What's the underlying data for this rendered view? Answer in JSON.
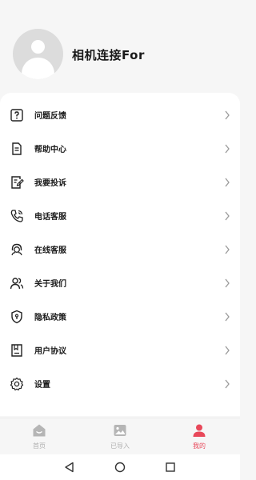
{
  "profile": {
    "username": "相机连接For"
  },
  "menu": {
    "items": [
      {
        "label": "问题反馈",
        "icon": "feedback-icon"
      },
      {
        "label": "帮助中心",
        "icon": "help-document-icon"
      },
      {
        "label": "我要投诉",
        "icon": "complaint-icon"
      },
      {
        "label": "电话客服",
        "icon": "phone-icon"
      },
      {
        "label": "在线客服",
        "icon": "headset-icon"
      },
      {
        "label": "关于我们",
        "icon": "people-icon"
      },
      {
        "label": "隐私政策",
        "icon": "shield-icon"
      },
      {
        "label": "用户协议",
        "icon": "agreement-icon"
      },
      {
        "label": "设置",
        "icon": "gear-icon"
      }
    ]
  },
  "tabbar": {
    "tabs": [
      {
        "label": "首页",
        "icon": "home-icon",
        "active": false
      },
      {
        "label": "已导入",
        "icon": "gallery-icon",
        "active": false
      },
      {
        "label": "我的",
        "icon": "user-icon",
        "active": true
      }
    ]
  },
  "colors": {
    "accent": "#e8485a",
    "icon_inactive": "#b5b5b5",
    "text_primary": "#1a1a1a",
    "background": "#f6f6f6"
  },
  "system_nav": {
    "icons": [
      "back-icon",
      "home-circle-icon",
      "recents-icon"
    ]
  }
}
